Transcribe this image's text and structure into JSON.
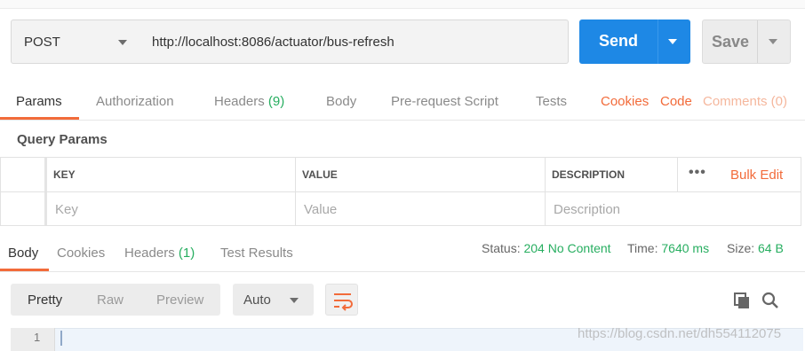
{
  "request": {
    "method": "POST",
    "url": "http://localhost:8086/actuator/bus-refresh",
    "send_label": "Send",
    "save_label": "Save"
  },
  "request_tabs": {
    "params": "Params",
    "authorization": "Authorization",
    "headers": "Headers",
    "headers_count": "(9)",
    "body": "Body",
    "pre_request": "Pre-request Script",
    "tests": "Tests",
    "cookies": "Cookies",
    "code": "Code",
    "comments": "Comments (0)",
    "active": "Params"
  },
  "query_params": {
    "title": "Query Params",
    "columns": [
      "KEY",
      "VALUE",
      "DESCRIPTION"
    ],
    "placeholders": [
      "Key",
      "Value",
      "Description"
    ],
    "more": "•••",
    "bulk_edit": "Bulk Edit"
  },
  "response": {
    "tabs": {
      "body": "Body",
      "cookies": "Cookies",
      "headers": "Headers",
      "headers_count": "(1)",
      "test_results": "Test Results",
      "active": "Body"
    },
    "status_label": "Status:",
    "status_value": "204 No Content",
    "time_label": "Time:",
    "time_value": "7640 ms",
    "size_label": "Size:",
    "size_value": "64 B",
    "formats": [
      "Pretty",
      "Raw",
      "Preview"
    ],
    "active_format": "Pretty",
    "language": "Auto",
    "line_number": "1"
  },
  "watermark": "https://blog.csdn.net/dh554112075",
  "colors": {
    "accent": "#f26b3a",
    "send": "#1e88e5",
    "status_green": "#27ae60"
  },
  "icons": {
    "method_dropdown": "chevron-down-icon",
    "send_dropdown": "chevron-down-icon",
    "wrap": "wrap-lines-icon",
    "copy": "copy-icon",
    "search": "search-icon"
  }
}
